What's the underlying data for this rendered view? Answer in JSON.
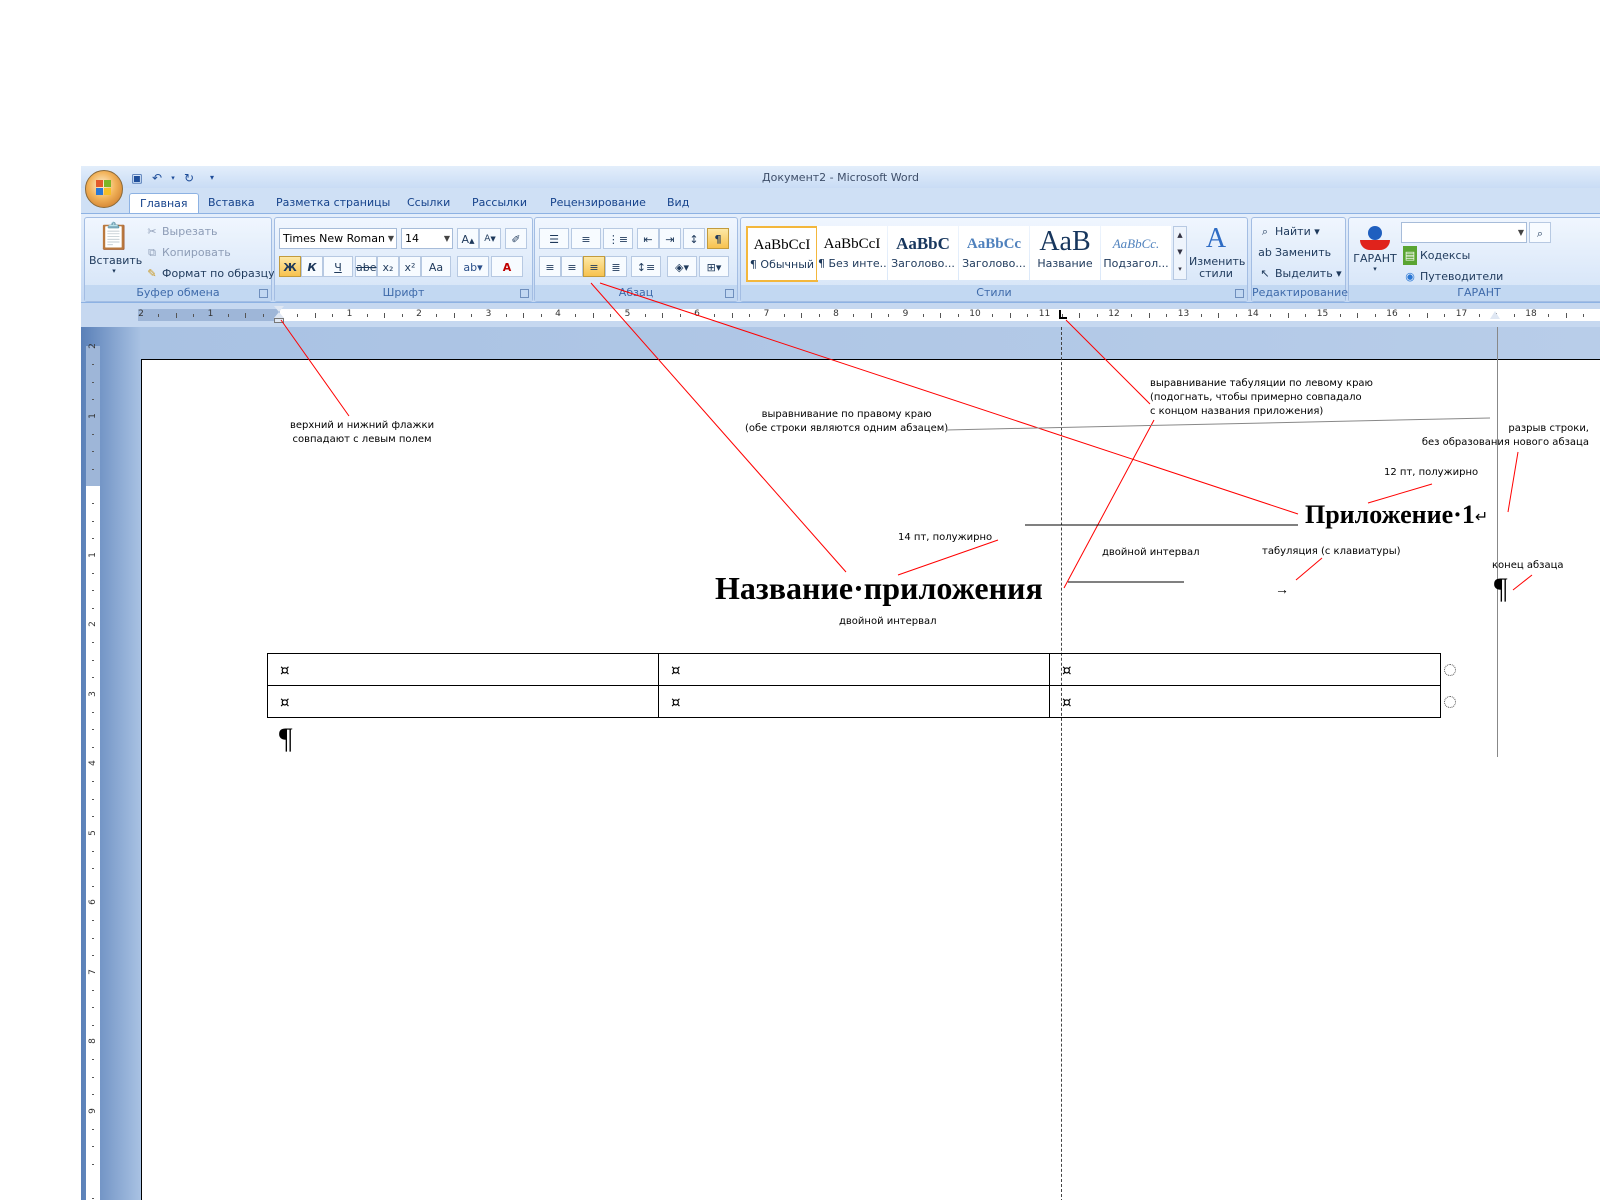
{
  "window": {
    "title": "Документ2 - Microsoft Word"
  },
  "tabs": [
    "Главная",
    "Вставка",
    "Разметка страницы",
    "Ссылки",
    "Рассылки",
    "Рецензирование",
    "Вид"
  ],
  "clipboard": {
    "paste": "Вставить",
    "cut": "Вырезать",
    "copy": "Копировать",
    "format_painter": "Формат по образцу",
    "group": "Буфер обмена"
  },
  "font": {
    "name": "Times New Roman",
    "size": "14",
    "group": "Шрифт",
    "bold": "Ж",
    "italic": "К",
    "underline": "Ч",
    "strike": "abe",
    "sub": "x₂",
    "sup": "x²",
    "case": "Aa",
    "text_color": "A"
  },
  "paragraph": {
    "group": "Абзац"
  },
  "styles": {
    "group": "Стили",
    "items": [
      {
        "sample": "AaBbCcI",
        "name": "¶ Обычный"
      },
      {
        "sample": "AaBbCcI",
        "name": "¶ Без инте..."
      },
      {
        "sample": "AaBbC",
        "name": "Заголово..."
      },
      {
        "sample": "AaBbCc",
        "name": "Заголово..."
      },
      {
        "sample": "AaB",
        "name": "Название"
      },
      {
        "sample": "AaBbCc.",
        "name": "Подзагол..."
      }
    ],
    "change_styles": "Изменить стили"
  },
  "editing": {
    "group": "Редактирование",
    "find": "Найти",
    "replace": "Заменить",
    "select": "Выделить"
  },
  "garant": {
    "group": "ГАРАНТ",
    "button": "ГАРАНТ",
    "codexes": "Кодексы",
    "guides": "Путеводители"
  },
  "ruler": {
    "numbers": [
      "2",
      "1",
      "1",
      "2",
      "3",
      "4",
      "5",
      "6",
      "7",
      "8",
      "9",
      "10",
      "11",
      "12",
      "13",
      "14",
      "15",
      "16",
      "17",
      "18"
    ]
  },
  "vruler": {
    "numbers": [
      "2",
      "1",
      "1",
      "2",
      "3",
      "4",
      "5",
      "6",
      "7",
      "8",
      "9"
    ]
  },
  "document": {
    "appendix_heading": "Приложение·1",
    "line_break_mark": "↵",
    "appendix_title": "Название·приложения",
    "tab_mark": "→",
    "pilcrow": "¶",
    "cell_mark": "¤"
  },
  "annotations": {
    "flags": "верхний и нижний флажки\nсовпадают с левым полем",
    "right_align": "выравнивание по правому краю\n(обе строки являются одним абзацем)",
    "tab_left": "выравнивание табуляции по левому краю\n(подогнать, чтобы примерно совпадало\nс концом названия приложения)",
    "line_break": "разрыв строки,\nбез образования нового абзаца",
    "pt12": "12 пт, полужирно",
    "pt14": "14 пт, полужирно",
    "double1": "двойной интервал",
    "tabulation": "табуляция (с клавиатуры)",
    "para_end": "конец абзаца",
    "double2": "двойной интервал"
  },
  "colors": {
    "annotation_lines": "#ff0000",
    "ribbon_accent": "#15428b",
    "highlight": "#f7c24f"
  }
}
